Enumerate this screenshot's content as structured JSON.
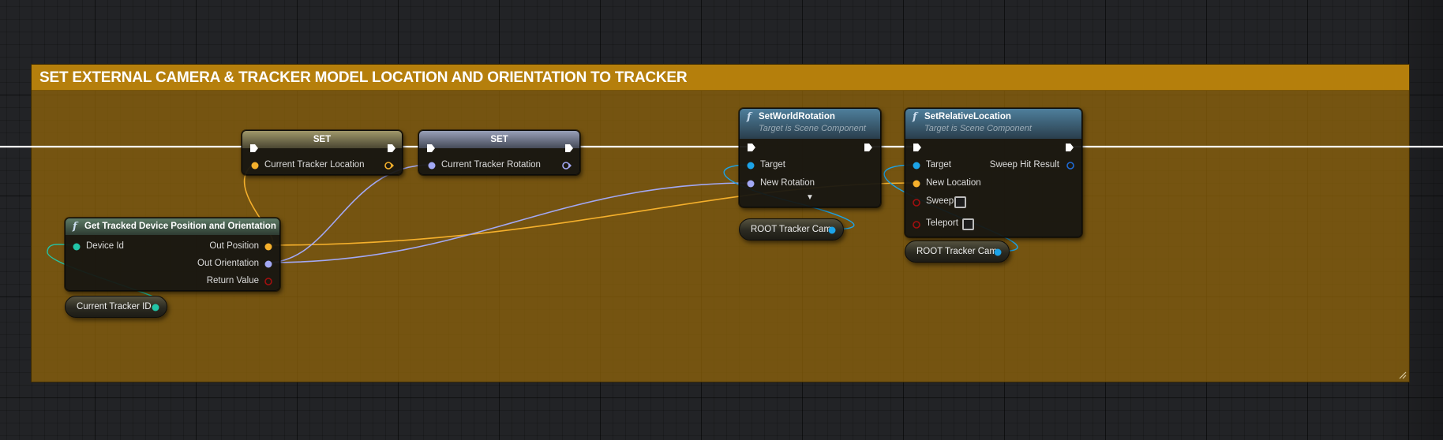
{
  "comment": {
    "title": "SET EXTERNAL CAMERA & TRACKER MODEL LOCATION AND ORIENTATION TO TRACKER",
    "color": "#b57f0c"
  },
  "colors": {
    "exec": "#ffffff",
    "vector_pin": "#f5b02c",
    "rotator_pin": "#a2a8f4",
    "integer_pin": "#22c5a8",
    "object_pin": "#1ca3e8",
    "struct_pin": "#1f6bd6",
    "bool_pin": "#a10f0f"
  },
  "nodes": {
    "get_tracked": {
      "title": "Get Tracked Device Position and Orientation",
      "icon": "function-icon",
      "inputs": [
        "Device Id"
      ],
      "outputs": [
        "Out Position",
        "Out Orientation",
        "Return Value"
      ]
    },
    "current_tracker_id": {
      "label": "Current Tracker ID"
    },
    "set_location": {
      "title": "SET",
      "input": "Current Tracker Location"
    },
    "set_rotation": {
      "title": "SET",
      "input": "Current Tracker Rotation"
    },
    "set_world_rotation": {
      "title": "SetWorldRotation",
      "subtitle": "Target is Scene Component",
      "icon": "function-icon",
      "inputs": [
        "Target",
        "New Rotation"
      ],
      "advanced_icon": "chevron-down-icon"
    },
    "root_tracker_cam_1": {
      "label": "ROOT Tracker Cam"
    },
    "set_relative_location": {
      "title": "SetRelativeLocation",
      "subtitle": "Target is Scene Component",
      "icon": "function-icon",
      "inputs": [
        "Target",
        "New Location",
        "Sweep",
        "Teleport"
      ],
      "outputs": [
        "Sweep Hit Result"
      ],
      "sweep_checked": false,
      "teleport_checked": false
    },
    "root_tracker_cam_2": {
      "label": "ROOT Tracker Cam"
    }
  }
}
